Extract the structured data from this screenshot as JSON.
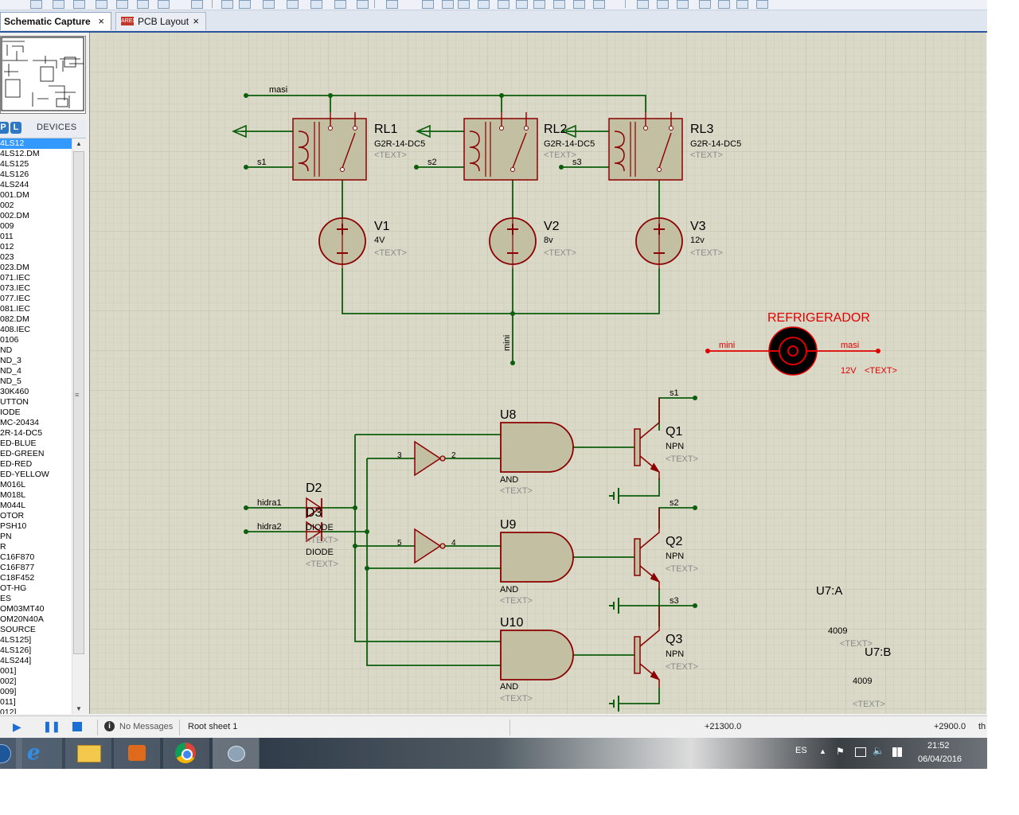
{
  "tabs": [
    {
      "label": "Schematic Capture",
      "close": "×",
      "active": true
    },
    {
      "label": "PCB Layout",
      "close": "×",
      "active": false,
      "icon_text": "ARES"
    }
  ],
  "devices": {
    "header_icons": [
      "P",
      "L"
    ],
    "title": "DEVICES",
    "items": [
      "4LS12",
      "4LS12.DM",
      "4LS125",
      "4LS126",
      "4LS244",
      "001.DM",
      "002",
      "002.DM",
      "009",
      "011",
      "012",
      "023",
      "023.DM",
      "071.IEC",
      "073.IEC",
      "077.IEC",
      "081.IEC",
      "082.DM",
      "408.IEC",
      "0106",
      "ND",
      "ND_3",
      "ND_4",
      "ND_5",
      "30K460",
      "UTTON",
      "IODE",
      "MC-20434",
      "2R-14-DC5",
      "ED-BLUE",
      "ED-GREEN",
      "ED-RED",
      "ED-YELLOW",
      "M016L",
      "M018L",
      "M044L",
      "OTOR",
      "PSH10",
      "PN",
      "R",
      "C16F870",
      "C16F877",
      "C18F452",
      "OT-HG",
      "ES",
      "OM03MT40",
      "OM20N40A",
      "SOURCE",
      "4LS125]",
      "4LS126]",
      "4LS244]",
      "001]",
      "002]",
      "009]",
      "011]",
      "012]"
    ],
    "selected_index": 0,
    "scroll_grip": "≡"
  },
  "schematic": {
    "net_labels": {
      "masi_top": "masi",
      "s1_left": "s1",
      "s2_left": "s2",
      "s3_left": "s3",
      "mini_v": "mini",
      "mini_motor": "mini",
      "masi_motor": "masi",
      "s1_q": "s1",
      "s2_q": "s2",
      "s3_q": "s3",
      "hidra1": "hidra1",
      "hidra2": "hidra2"
    },
    "relays": [
      {
        "ref": "RL1",
        "part": "G2R-14-DC5",
        "text": "<TEXT>"
      },
      {
        "ref": "RL2",
        "part": "G2R-14-DC5",
        "text": "<TEXT>"
      },
      {
        "ref": "RL3",
        "part": "G2R-14-DC5",
        "text": "<TEXT>"
      }
    ],
    "sources": [
      {
        "ref": "V1",
        "value": "4V",
        "text": "<TEXT>"
      },
      {
        "ref": "V2",
        "value": "8v",
        "text": "<TEXT>"
      },
      {
        "ref": "V3",
        "value": "12v",
        "text": "<TEXT>"
      }
    ],
    "motor": {
      "ref": "REFRIGERADOR",
      "value": "12V",
      "text": "<TEXT>"
    },
    "gates": [
      {
        "ref": "U8",
        "type": "AND",
        "text": "<TEXT>"
      },
      {
        "ref": "U9",
        "type": "AND",
        "text": "<TEXT>"
      },
      {
        "ref": "U10",
        "type": "AND",
        "text": "<TEXT>"
      }
    ],
    "inverter_pins": {
      "in1": "3",
      "out1": "2",
      "in2": "5",
      "out2": "4"
    },
    "transistors": [
      {
        "ref": "Q1",
        "type": "NPN",
        "text": "<TEXT>"
      },
      {
        "ref": "Q2",
        "type": "NPN",
        "text": "<TEXT>"
      },
      {
        "ref": "Q3",
        "type": "NPN",
        "text": "<TEXT>"
      }
    ],
    "diodes": [
      {
        "ref": "D2",
        "type": "DIODE",
        "text": "<TEXT>"
      },
      {
        "ref": "D3",
        "type": "DIODE",
        "text": "<TEXT>"
      }
    ],
    "u7a": {
      "ref": "U7:A",
      "part": "4009",
      "text": "<TEXT>"
    },
    "u7b": {
      "ref": "U7:B",
      "part": "4009",
      "text": "<TEXT>"
    }
  },
  "status_bar": {
    "messages": "No Messages",
    "sheet": "Root sheet 1",
    "coord_x": "+21300.0",
    "coord_y": "+2900.0",
    "unit": "th"
  },
  "taskbar": {
    "lang": "ES",
    "time": "21:52",
    "date": "06/04/2016"
  },
  "colors": {
    "wire": "#0b5e0b",
    "component": "#8b0000",
    "fill": "#c3bfa2",
    "motor": "#e00000",
    "canvas": "#dad8c6"
  }
}
